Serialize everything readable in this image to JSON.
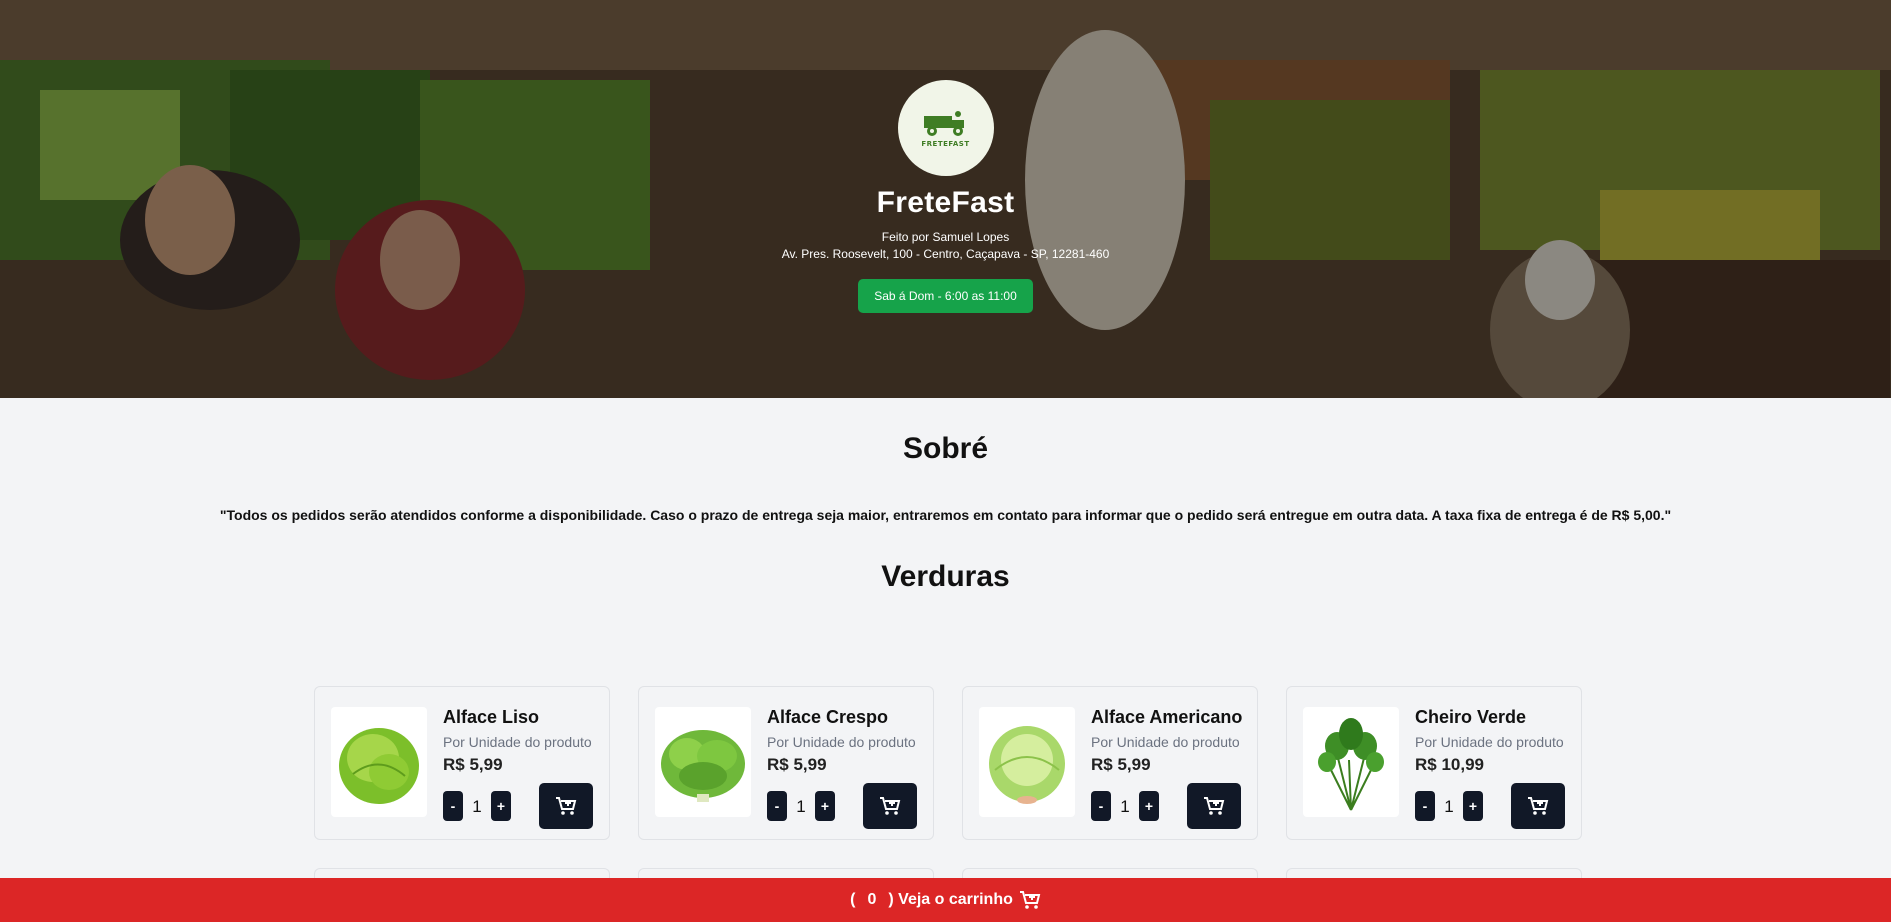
{
  "hero": {
    "logo_text": "FRETEFAST",
    "brand": "FreteFast",
    "byline": "Feito por Samuel Lopes",
    "address": "Av. Pres. Roosevelt, 100 - Centro, Caçapava - SP, 12281-460",
    "hours": "Sab á Dom - 6:00 as 11:00"
  },
  "about": {
    "title": "Sobré",
    "text": "\"Todos os pedidos serão atendidos conforme a disponibilidade. Caso o prazo de entrega seja maior, entraremos em contato para informar que o pedido será entregue em outra data. A taxa fixa de entrega é de R$ 5,00.\""
  },
  "section": {
    "title": "Verduras"
  },
  "products": [
    {
      "name": "Alface Liso",
      "unit": "Por Unidade do produto",
      "price": "R$ 5,99",
      "qty": "1",
      "minus": "-",
      "plus": "+"
    },
    {
      "name": "Alface Crespo",
      "unit": "Por Unidade do produto",
      "price": "R$ 5,99",
      "qty": "1",
      "minus": "-",
      "plus": "+"
    },
    {
      "name": "Alface Americano",
      "unit": "Por Unidade do produto",
      "price": "R$ 5,99",
      "qty": "1",
      "minus": "-",
      "plus": "+"
    },
    {
      "name": "Cheiro Verde",
      "unit": "Por Unidade do produto",
      "price": "R$ 10,99",
      "qty": "1",
      "minus": "-",
      "plus": "+"
    }
  ],
  "cart_bar": {
    "open_paren": "(",
    "count": "0",
    "close_label": ") Veja o carrinho"
  },
  "colors": {
    "hours_badge": "#16a34a",
    "cart_bar": "#dc2626",
    "dark_button": "#111827"
  }
}
